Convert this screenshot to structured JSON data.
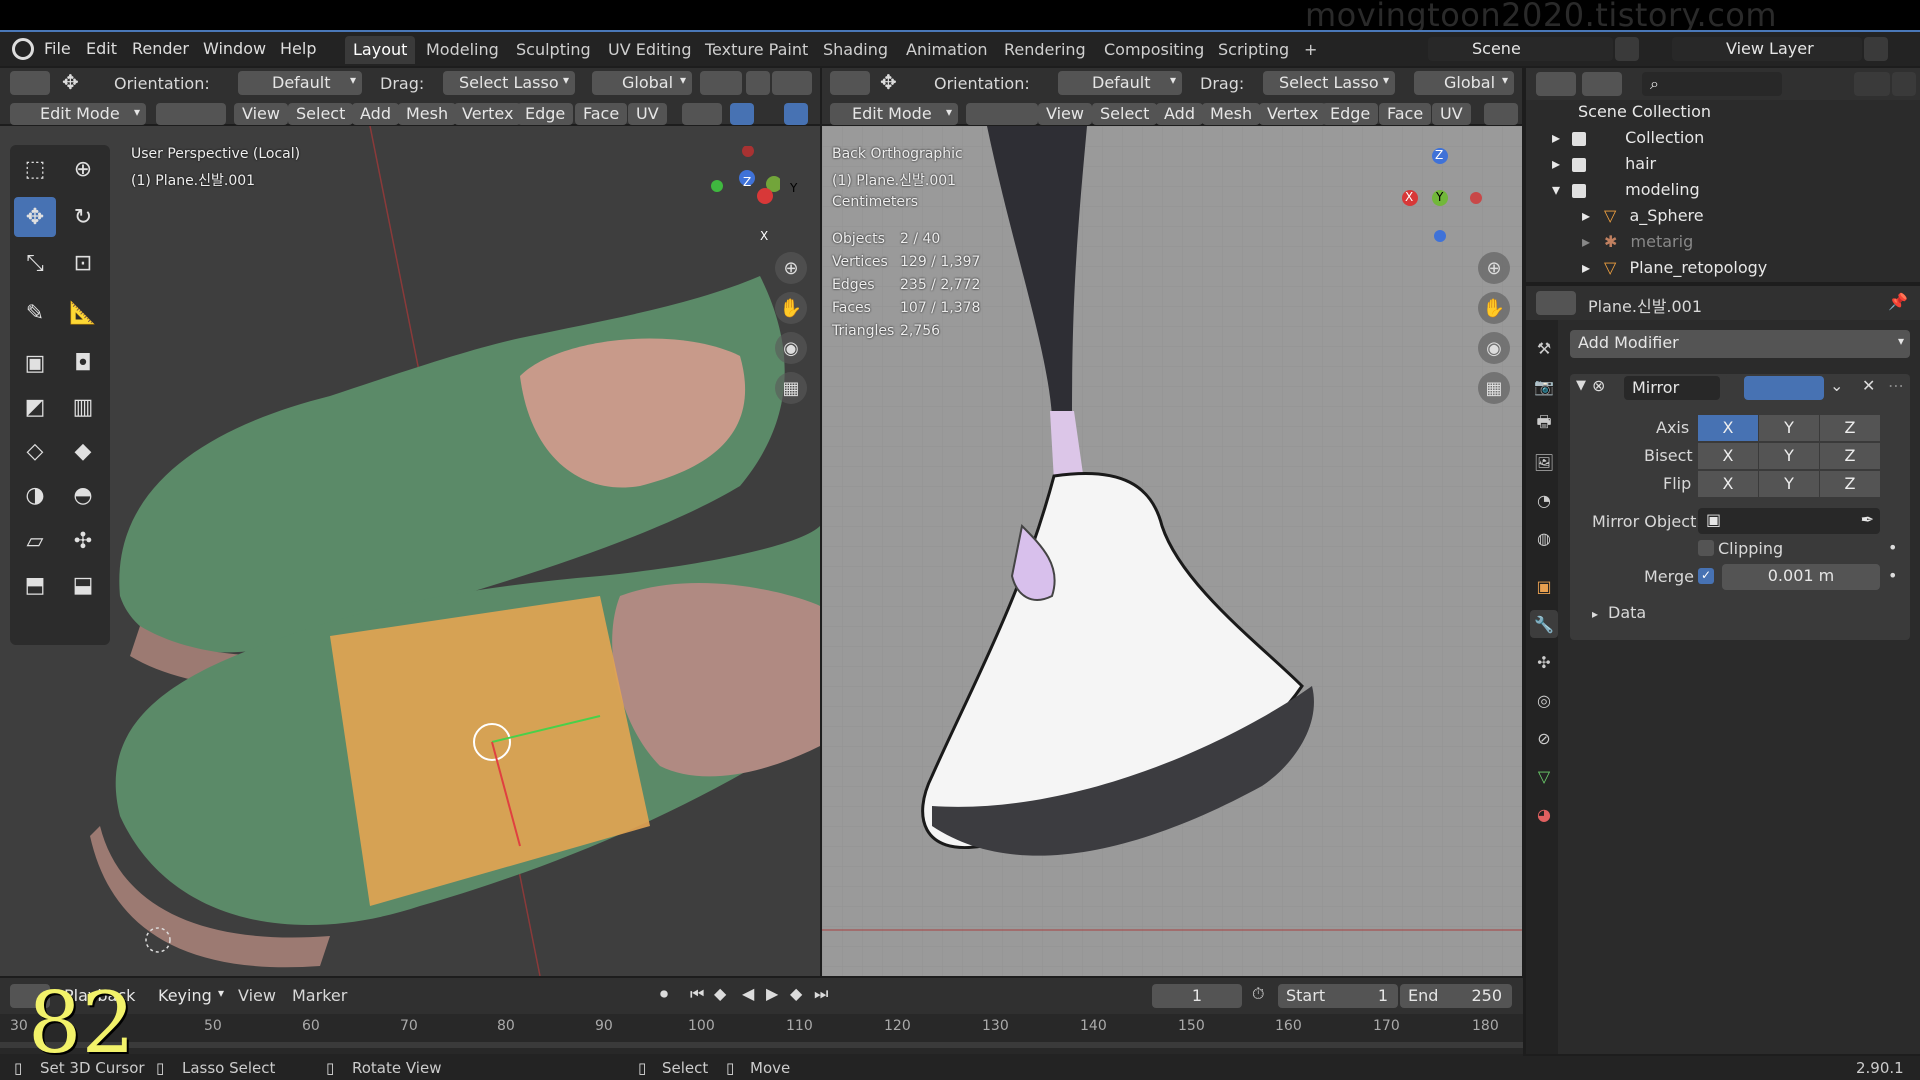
{
  "watermark": "movingtoon2020.tistory.com",
  "menu": [
    "File",
    "Edit",
    "Render",
    "Window",
    "Help"
  ],
  "workspaces": [
    "Layout",
    "Modeling",
    "Sculpting",
    "UV Editing",
    "Texture Paint",
    "Shading",
    "Animation",
    "Rendering",
    "Compositing",
    "Scripting"
  ],
  "active_workspace": "Layout",
  "scene": {
    "label": "Scene",
    "view_layer": "View Layer"
  },
  "left_view": {
    "orientation_label": "Orientation:",
    "orientation_value": "Default",
    "drag_label": "Drag:",
    "drag_value": "Select Lasso",
    "transform": "Global",
    "mode": "Edit Mode",
    "menus": [
      "View",
      "Select",
      "Add",
      "Mesh",
      "Vertex",
      "Edge",
      "Face",
      "UV"
    ],
    "overlay_line1": "User Perspective (Local)",
    "overlay_line2": "(1) Plane.신발.001"
  },
  "right_view": {
    "orientation_label": "Orientation:",
    "orientation_value": "Default",
    "drag_label": "Drag:",
    "drag_value": "Select Lasso",
    "transform": "Global",
    "mode": "Edit Mode",
    "menus": [
      "View",
      "Select",
      "Add",
      "Mesh",
      "Vertex",
      "Edge",
      "Face",
      "UV"
    ],
    "overlay_line1": "Back Orthographic",
    "overlay_line2": "(1) Plane.신발.001",
    "overlay_line3": "Centimeters",
    "stats": [
      {
        "label": "Objects",
        "value": "2 / 40"
      },
      {
        "label": "Vertices",
        "value": "129 / 1,397"
      },
      {
        "label": "Edges",
        "value": "235 / 2,772"
      },
      {
        "label": "Faces",
        "value": "107 / 1,378"
      },
      {
        "label": "Triangles",
        "value": "2,756"
      }
    ]
  },
  "outliner": {
    "root": "Scene Collection",
    "items": [
      {
        "name": "Collection"
      },
      {
        "name": "hair"
      },
      {
        "name": "modeling"
      },
      {
        "name": "a_Sphere"
      },
      {
        "name": "metarig"
      },
      {
        "name": "Plane_retopology"
      }
    ]
  },
  "properties": {
    "object_name": "Plane.신발.001",
    "add_modifier": "Add Modifier",
    "modifier_name": "Mirror",
    "axis_label": "Axis",
    "bisect_label": "Bisect",
    "flip_label": "Flip",
    "xyz": [
      "X",
      "Y",
      "Z"
    ],
    "mirror_object_label": "Mirror Object",
    "clipping_label": "Clipping",
    "merge_label": "Merge",
    "merge_value": "0.001 m",
    "data_label": "Data"
  },
  "timeline": {
    "playback": "Playback",
    "keying": "Keying",
    "view": "View",
    "marker": "Marker",
    "current_frame": "1",
    "start_label": "Start",
    "start_value": "1",
    "end_label": "End",
    "end_value": "250",
    "ticks": [
      "30",
      "50",
      "60",
      "70",
      "80",
      "90",
      "100",
      "110",
      "120",
      "130",
      "140",
      "150",
      "160",
      "170",
      "180"
    ],
    "overlay_number": "82"
  },
  "status": {
    "items": [
      "Set 3D Cursor",
      "Lasso Select",
      "Rotate View",
      "Select",
      "Move"
    ],
    "version": "2.90.1"
  },
  "gizmo": {
    "x": "X",
    "y": "Y",
    "z": "Z"
  }
}
